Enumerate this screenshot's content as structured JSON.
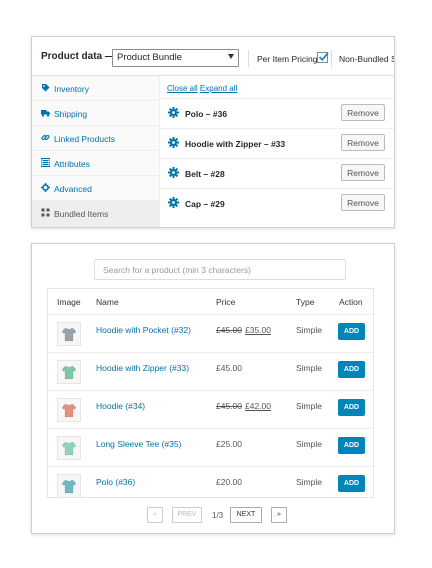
{
  "product_data": {
    "title": "Product data —",
    "type_select": "Product Bundle",
    "per_item_pricing_label": "Per Item Pricing:",
    "per_item_pricing_checked": true,
    "non_bundled_label": "Non-Bundled S"
  },
  "tabs": [
    {
      "label": "Inventory",
      "icon": "tag-icon"
    },
    {
      "label": "Shipping",
      "icon": "truck-icon"
    },
    {
      "label": "Linked Products",
      "icon": "link-icon"
    },
    {
      "label": "Attributes",
      "icon": "list-icon"
    },
    {
      "label": "Advanced",
      "icon": "gear-icon"
    },
    {
      "label": "Bundled Items",
      "icon": "grid-icon",
      "active": true
    }
  ],
  "bundle": {
    "close_all": "Close all",
    "expand_all": "Expand all",
    "remove_label": "Remove",
    "items": [
      {
        "name": "Polo – #36"
      },
      {
        "name": "Hoodie with Zipper – #33"
      },
      {
        "name": "Belt – #28"
      },
      {
        "name": "Cap – #29"
      }
    ]
  },
  "search": {
    "placeholder": "Search for a product (min 3 characters)"
  },
  "results": {
    "headers": {
      "image": "Image",
      "name": "Name",
      "price": "Price",
      "type": "Type",
      "action": "Action"
    },
    "add_label": "ADD",
    "rows": [
      {
        "name": "Hoodie with Pocket (#32)",
        "price_old": "£45.00",
        "price": "£35.00",
        "type": "Simple",
        "thumb_color": "#9aa3a8"
      },
      {
        "name": "Hoodie with Zipper (#33)",
        "price_old": "",
        "price": "£45.00",
        "type": "Simple",
        "thumb_color": "#7fc6a8"
      },
      {
        "name": "Hoodie (#34)",
        "price_old": "£45.00",
        "price": "£42.00",
        "type": "Simple",
        "thumb_color": "#e8907f"
      },
      {
        "name": "Long Sleeve Tee (#35)",
        "price_old": "",
        "price": "£25.00",
        "type": "Simple",
        "thumb_color": "#8fd3b5"
      },
      {
        "name": "Polo (#36)",
        "price_old": "",
        "price": "£20.00",
        "type": "Simple",
        "thumb_color": "#6fb8c4"
      }
    ]
  },
  "pagination": {
    "first": "«",
    "prev": "PREV",
    "info": "1/3",
    "next": "NEXT",
    "last": "»"
  }
}
